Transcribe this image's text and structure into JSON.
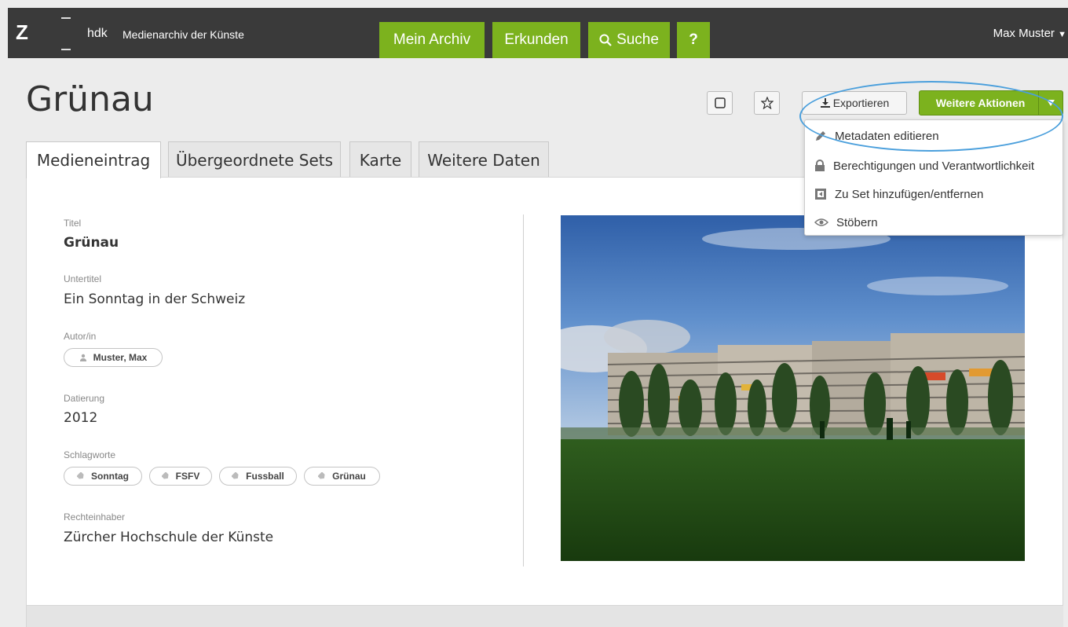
{
  "header": {
    "logo_letter": "Z",
    "brand": "hdk",
    "subtitle": "Medienarchiv der Künste",
    "nav": {
      "mein_archiv": "Mein Archiv",
      "erkunden": "Erkunden",
      "suche": "Suche",
      "help": "?"
    },
    "user": "Max Muster"
  },
  "page": {
    "title": "Grünau"
  },
  "actions": {
    "export": "Exportieren",
    "more": "Weitere Aktionen"
  },
  "dropdown": {
    "items": [
      {
        "label": "Metadaten editieren",
        "icon": "pencil-icon"
      },
      {
        "label": "Berechtigungen und Verantwortlichkeit",
        "icon": "lock-icon"
      },
      {
        "label": "Zu Set hinzufügen/entfernen",
        "icon": "set-icon"
      },
      {
        "label": "Stöbern",
        "icon": "eye-icon"
      }
    ]
  },
  "tabs": [
    {
      "label": "Medieneintrag",
      "active": true
    },
    {
      "label": "Übergeordnete Sets",
      "active": false
    },
    {
      "label": "Karte",
      "active": false
    },
    {
      "label": "Weitere Daten",
      "active": false
    }
  ],
  "metadata": {
    "titel_label": "Titel",
    "titel_value": "Grünau",
    "untertitel_label": "Untertitel",
    "untertitel_value": "Ein Sonntag in der Schweiz",
    "autor_label": "Autor/in",
    "autor_value": "Muster, Max",
    "datierung_label": "Datierung",
    "datierung_value": "2012",
    "schlagworte_label": "Schlagworte",
    "schlagworte": [
      "Sonntag",
      "FSFV",
      "Fussball",
      "Grünau"
    ],
    "rechteinhaber_label": "Rechteinhaber",
    "rechteinhaber_value": "Zürcher Hochschule der Künste"
  },
  "colors": {
    "accent_green": "#7cb21e",
    "topbar": "#3a3a3a",
    "highlight": "#4a9fdc"
  }
}
